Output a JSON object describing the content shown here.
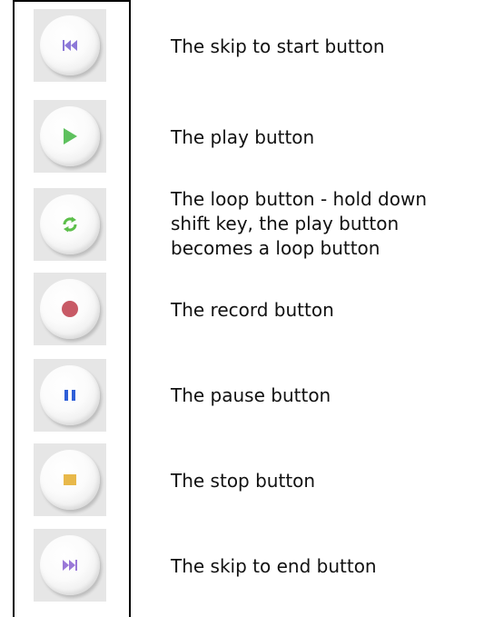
{
  "rows": [
    {
      "label": "The skip to start button",
      "icon": "skip-to-start-icon",
      "color": "#8c78d8"
    },
    {
      "label": "The play button",
      "icon": "play-icon",
      "color": "#5ec15e"
    },
    {
      "label": "The loop button - hold down\nshift key, the play button\nbecomes a loop button",
      "icon": "loop-icon",
      "color": "#5cbf4a"
    },
    {
      "label": "The record button",
      "icon": "record-icon",
      "color": "#c85a66"
    },
    {
      "label": "The pause button",
      "icon": "pause-icon",
      "color": "#2f5fd8"
    },
    {
      "label": "The stop button",
      "icon": "stop-icon",
      "color": "#e8b84a"
    },
    {
      "label": "The skip to end button",
      "icon": "skip-to-end-icon",
      "color": "#9a78d8"
    }
  ]
}
